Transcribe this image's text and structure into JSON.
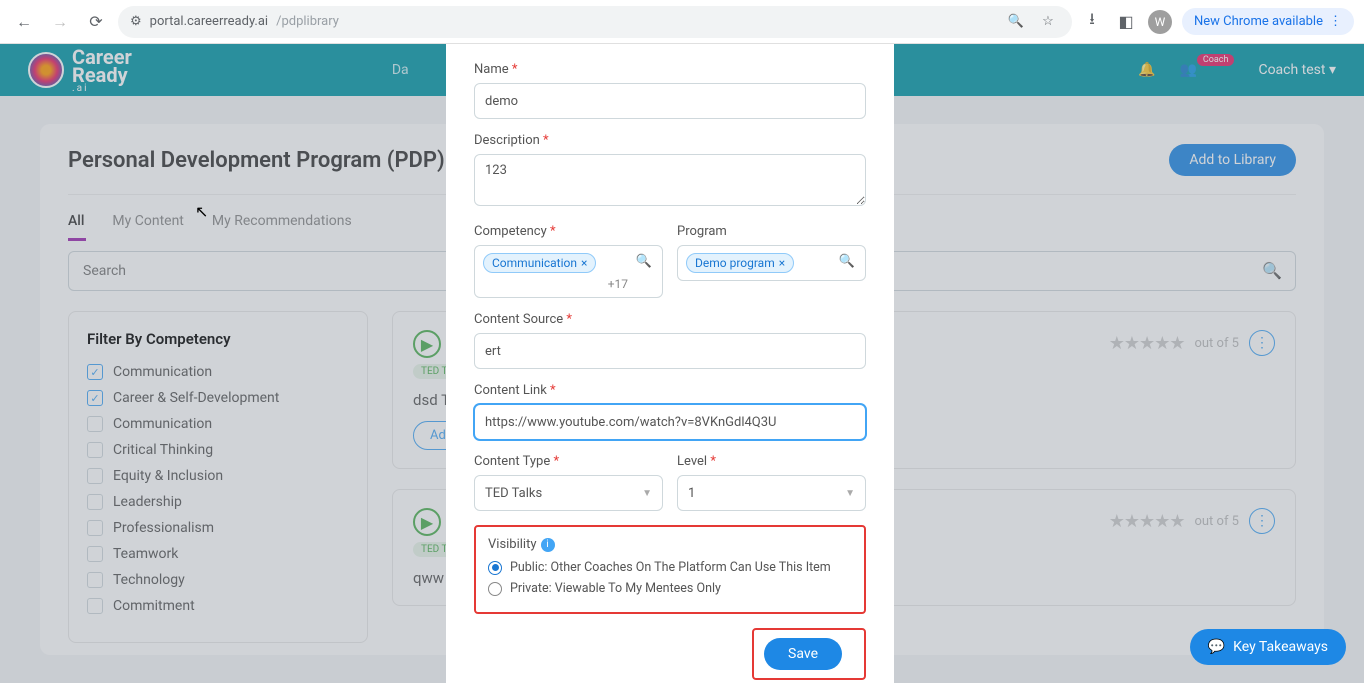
{
  "browser": {
    "url_prefix": "portal.careerready.ai",
    "url_path": "/pdplibrary",
    "avatar_letter": "W",
    "update_label": "New Chrome available"
  },
  "header": {
    "logo_line1": "Career",
    "logo_line2": "Ready",
    "logo_suffix": ".ai",
    "nav_item": "Da",
    "coach_badge": "Coach",
    "user_name": "Coach test"
  },
  "page": {
    "title": "Personal Development Program (PDP) Library",
    "add_button": "Add to Library",
    "tabs": {
      "all": "All",
      "my_content": "My Content",
      "my_recs": "My Recommendations"
    },
    "search_placeholder": "Search"
  },
  "filter": {
    "title": "Filter By Competency",
    "items": [
      {
        "label": "Communication",
        "checked": true
      },
      {
        "label": "Career & Self-Development",
        "checked": true
      },
      {
        "label": "Communication",
        "checked": false
      },
      {
        "label": "Critical Thinking",
        "checked": false
      },
      {
        "label": "Equity & Inclusion",
        "checked": false
      },
      {
        "label": "Leadership",
        "checked": false
      },
      {
        "label": "Professionalism",
        "checked": false
      },
      {
        "label": "Teamwork",
        "checked": false
      },
      {
        "label": "Technology",
        "checked": false
      },
      {
        "label": "Commitment",
        "checked": false
      }
    ]
  },
  "cards": [
    {
      "tag": "TED Talks",
      "title": "dsd TED T",
      "out_of": "out of 5",
      "btn": "Add t"
    },
    {
      "tag": "TED Talks",
      "title": "qww TED",
      "out_of": "out of 5"
    }
  ],
  "modal": {
    "name_label": "Name",
    "name_value": "demo",
    "desc_label": "Description",
    "desc_value": "123",
    "competency_label": "Competency",
    "competency_chip": "Communication",
    "competency_more": "+17",
    "program_label": "Program",
    "program_chip": "Demo program",
    "source_label": "Content Source",
    "source_value": "ert",
    "link_label": "Content Link",
    "link_value": "https://www.youtube.com/watch?v=8VKnGdl4Q3U",
    "type_label": "Content Type",
    "type_value": "TED Talks",
    "level_label": "Level",
    "level_value": "1",
    "visibility_label": "Visibility",
    "radio_public": "Public: Other Coaches On The Platform Can Use This Item",
    "radio_private": "Private: Viewable To My Mentees Only",
    "save_label": "Save"
  },
  "kt": {
    "label": "Key Takeaways"
  }
}
